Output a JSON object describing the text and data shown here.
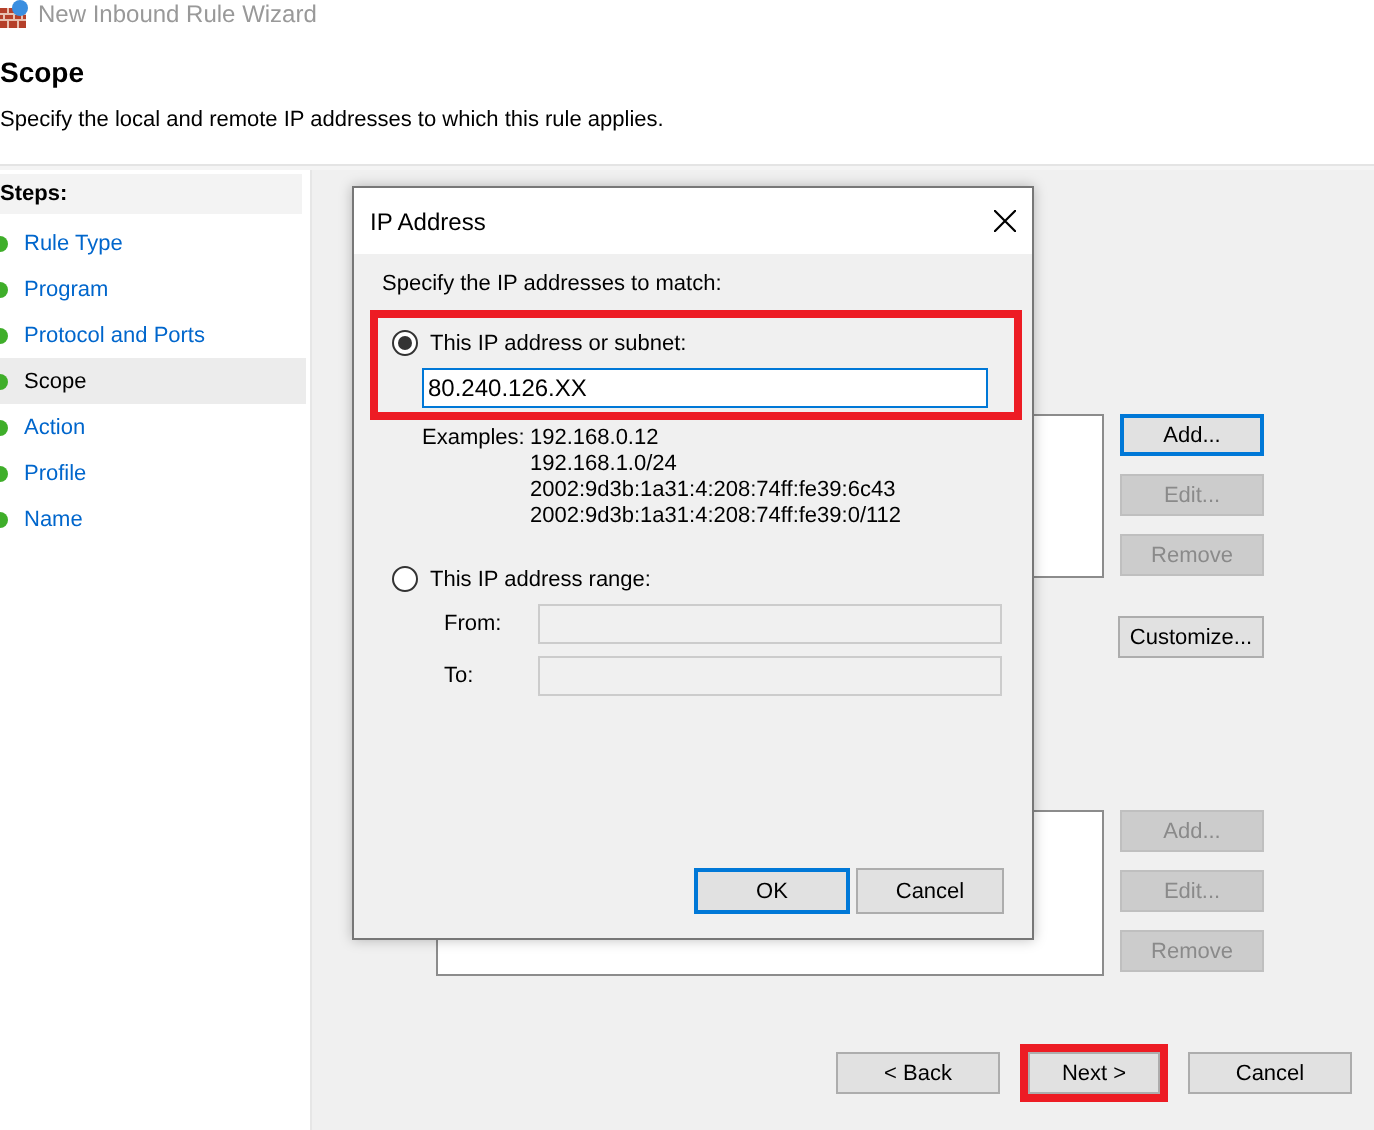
{
  "window": {
    "title": "New Inbound Rule Wizard"
  },
  "header": {
    "title": "Scope",
    "description": "Specify the local and remote IP addresses to which this rule applies."
  },
  "steps": {
    "heading": "Steps:",
    "items": [
      {
        "label": "Rule Type",
        "selected": false
      },
      {
        "label": "Program",
        "selected": false
      },
      {
        "label": "Protocol and Ports",
        "selected": false
      },
      {
        "label": "Scope",
        "selected": true
      },
      {
        "label": "Action",
        "selected": false
      },
      {
        "label": "Profile",
        "selected": false
      },
      {
        "label": "Name",
        "selected": false
      }
    ]
  },
  "local_buttons": [
    {
      "label": "Add...",
      "disabled": false,
      "default": true
    },
    {
      "label": "Edit...",
      "disabled": true,
      "default": false
    },
    {
      "label": "Remove",
      "disabled": true,
      "default": false
    }
  ],
  "customize_button": {
    "label": "Customize..."
  },
  "remote_buttons": [
    {
      "label": "Add...",
      "disabled": true,
      "default": false
    },
    {
      "label": "Edit...",
      "disabled": true,
      "default": false
    },
    {
      "label": "Remove",
      "disabled": true,
      "default": false
    }
  ],
  "footer_buttons": [
    {
      "label": "< Back",
      "highlighted": false
    },
    {
      "label": "Next >",
      "highlighted": true
    },
    {
      "label": "Cancel",
      "highlighted": false
    }
  ],
  "dialog": {
    "title": "IP Address",
    "prompt": "Specify the IP addresses to match:",
    "options": [
      {
        "kind": "subnet",
        "label": "This IP address or subnet:",
        "selected": true,
        "highlighted": true,
        "value": "80.240.126.XX",
        "examples_label": "Examples:",
        "examples": [
          "192.168.0.12",
          "192.168.1.0/24",
          "2002:9d3b:1a31:4:208:74ff:fe39:6c43",
          "2002:9d3b:1a31:4:208:74ff:fe39:0/112"
        ]
      },
      {
        "kind": "range",
        "label": "This IP address range:",
        "selected": false,
        "highlighted": false,
        "fields": [
          {
            "label": "From:"
          },
          {
            "label": "To:"
          }
        ]
      }
    ],
    "buttons": [
      {
        "label": "OK",
        "default": true
      },
      {
        "label": "Cancel",
        "default": false
      }
    ]
  }
}
